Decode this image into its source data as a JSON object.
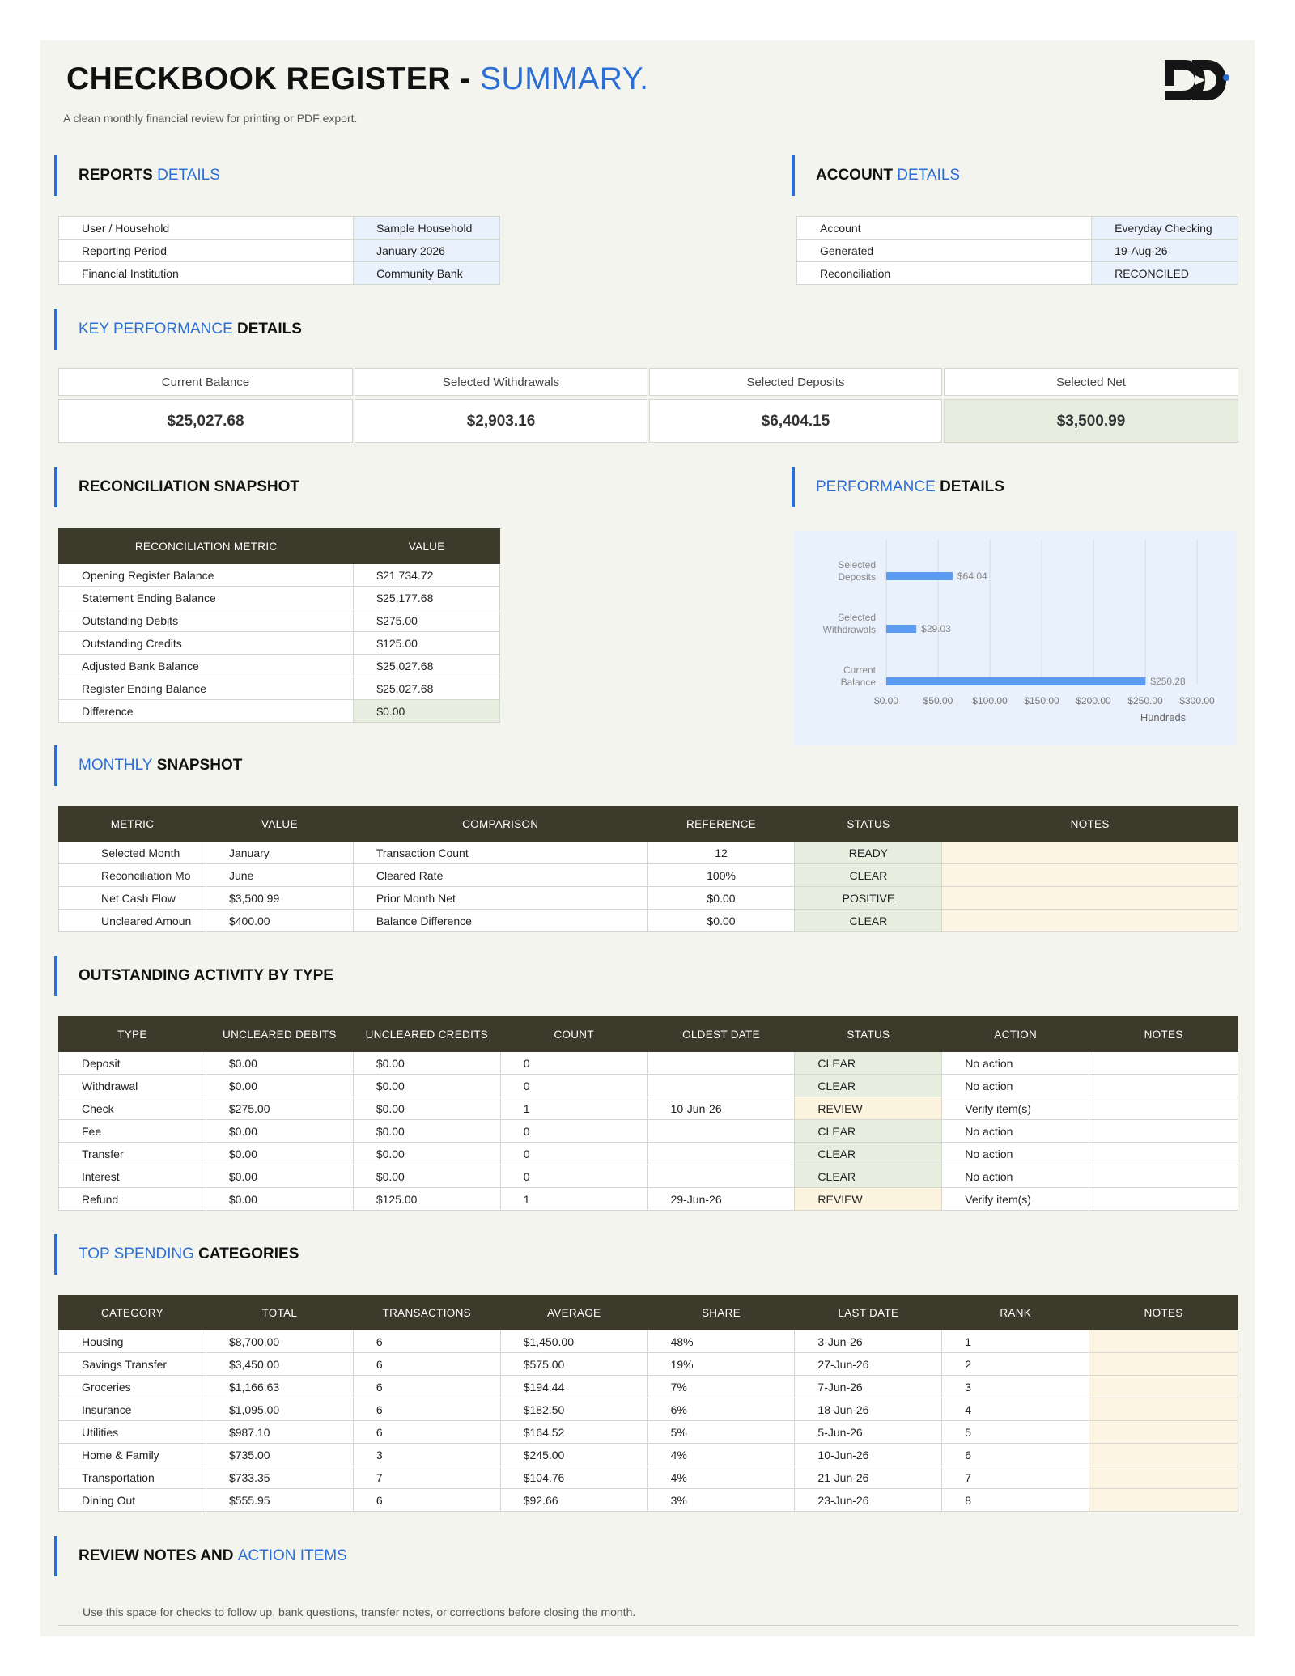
{
  "header": {
    "title_main": "CHECKBOOK REGISTER - ",
    "title_accent": "SUMMARY.",
    "subtitle": "A clean monthly financial review for printing or PDF export."
  },
  "reports": {
    "head_bold": "REPORTS",
    "head_light": "DETAILS",
    "rows": [
      {
        "k": "User / Household",
        "v": "Sample Household"
      },
      {
        "k": "Reporting Period",
        "v": "January 2026"
      },
      {
        "k": "Financial Institution",
        "v": "Community Bank"
      }
    ]
  },
  "account": {
    "head_bold": "ACCOUNT",
    "head_light": "DETAILS",
    "rows": [
      {
        "k": "Account",
        "v": "Everyday Checking"
      },
      {
        "k": "Generated",
        "v": "19-Aug-26"
      },
      {
        "k": "Reconciliation",
        "v": "RECONCILED"
      }
    ]
  },
  "kpi": {
    "head_light": "KEY PERFORMANCE",
    "head_bold": "DETAILS",
    "cards": [
      {
        "label": "Current Balance",
        "value": "$25,027.68"
      },
      {
        "label": "Selected Withdrawals",
        "value": "$2,903.16"
      },
      {
        "label": "Selected Deposits",
        "value": "$6,404.15"
      },
      {
        "label": "Selected Net",
        "value": "$3,500.99"
      }
    ]
  },
  "reconciliation": {
    "head": "RECONCILIATION SNAPSHOT",
    "col_metric": "RECONCILIATION METRIC",
    "col_value": "VALUE",
    "rows": [
      {
        "k": "Opening Register Balance",
        "v": "$21,734.72"
      },
      {
        "k": "Statement Ending Balance",
        "v": "$25,177.68"
      },
      {
        "k": "Outstanding Debits",
        "v": "$275.00"
      },
      {
        "k": "Outstanding Credits",
        "v": "$125.00"
      },
      {
        "k": "Adjusted Bank Balance",
        "v": "$25,027.68"
      },
      {
        "k": "Register Ending Balance",
        "v": "$25,027.68"
      },
      {
        "k": "Difference",
        "v": "$0.00"
      }
    ]
  },
  "performance": {
    "head_light": "PERFORMANCE",
    "head_bold": "DETAILS"
  },
  "chart_data": {
    "type": "bar",
    "orientation": "horizontal",
    "categories": [
      "Selected Deposits",
      "Selected Withdrawals",
      "Current Balance"
    ],
    "category_lines": [
      [
        "Selected",
        "Deposits"
      ],
      [
        "Selected",
        "Withdrawals"
      ],
      [
        "Current",
        "Balance"
      ]
    ],
    "values": [
      64.04,
      29.03,
      250.28
    ],
    "data_labels": [
      "$64.04",
      "$29.03",
      "$250.28"
    ],
    "xlim": [
      0,
      300
    ],
    "xticks": [
      0,
      50,
      100,
      150,
      200,
      250,
      300
    ],
    "xtick_labels": [
      "$0.00",
      "$50.00",
      "$100.00",
      "$150.00",
      "$200.00",
      "$250.00",
      "$300.00"
    ],
    "xunit": "Hundreds",
    "grid": true,
    "bar_color": "#5b9cf2",
    "background": "#e9f1fc"
  },
  "monthly": {
    "head_light": "MONTHLY",
    "head_bold": "SNAPSHOT",
    "columns": [
      "METRIC",
      "VALUE",
      "COMPARISON",
      "REFERENCE",
      "STATUS",
      "NOTES"
    ],
    "rows": [
      {
        "metric": "Selected Month",
        "value": "January",
        "comparison": "Transaction Count",
        "reference": "12",
        "status": "READY",
        "notes": ""
      },
      {
        "metric": "Reconciliation Mo",
        "value": "June",
        "comparison": "Cleared Rate",
        "reference": "100%",
        "status": "CLEAR",
        "notes": ""
      },
      {
        "metric": "Net Cash Flow",
        "value": "$3,500.99",
        "comparison": "Prior Month Net",
        "reference": "$0.00",
        "status": "POSITIVE",
        "notes": ""
      },
      {
        "metric": "Uncleared Amoun",
        "value": "$400.00",
        "comparison": "Balance Difference",
        "reference": "$0.00",
        "status": "CLEAR",
        "notes": ""
      }
    ]
  },
  "outstanding": {
    "head": "OUTSTANDING ACTIVITY BY TYPE",
    "columns": [
      "TYPE",
      "UNCLEARED DEBITS",
      "UNCLEARED CREDITS",
      "COUNT",
      "OLDEST DATE",
      "STATUS",
      "ACTION",
      "NOTES"
    ],
    "rows": [
      {
        "type": "Deposit",
        "debits": "$0.00",
        "credits": "$0.00",
        "count": "0",
        "oldest": "",
        "status": "CLEAR",
        "action": "No action",
        "notes": ""
      },
      {
        "type": "Withdrawal",
        "debits": "$0.00",
        "credits": "$0.00",
        "count": "0",
        "oldest": "",
        "status": "CLEAR",
        "action": "No action",
        "notes": ""
      },
      {
        "type": "Check",
        "debits": "$275.00",
        "credits": "$0.00",
        "count": "1",
        "oldest": "10-Jun-26",
        "status": "REVIEW",
        "action": "Verify item(s)",
        "notes": ""
      },
      {
        "type": "Fee",
        "debits": "$0.00",
        "credits": "$0.00",
        "count": "0",
        "oldest": "",
        "status": "CLEAR",
        "action": "No action",
        "notes": ""
      },
      {
        "type": "Transfer",
        "debits": "$0.00",
        "credits": "$0.00",
        "count": "0",
        "oldest": "",
        "status": "CLEAR",
        "action": "No action",
        "notes": ""
      },
      {
        "type": "Interest",
        "debits": "$0.00",
        "credits": "$0.00",
        "count": "0",
        "oldest": "",
        "status": "CLEAR",
        "action": "No action",
        "notes": ""
      },
      {
        "type": "Refund",
        "debits": "$0.00",
        "credits": "$125.00",
        "count": "1",
        "oldest": "29-Jun-26",
        "status": "REVIEW",
        "action": "Verify item(s)",
        "notes": ""
      }
    ]
  },
  "spending": {
    "head_light": "TOP SPENDING",
    "head_bold": "CATEGORIES",
    "columns": [
      "CATEGORY",
      "TOTAL",
      "TRANSACTIONS",
      "AVERAGE",
      "SHARE",
      "LAST DATE",
      "RANK",
      "NOTES"
    ],
    "rows": [
      {
        "category": "Housing",
        "total": "$8,700.00",
        "tx": "6",
        "avg": "$1,450.00",
        "share": "48%",
        "last": "3-Jun-26",
        "rank": "1",
        "notes": ""
      },
      {
        "category": "Savings Transfer",
        "total": "$3,450.00",
        "tx": "6",
        "avg": "$575.00",
        "share": "19%",
        "last": "27-Jun-26",
        "rank": "2",
        "notes": ""
      },
      {
        "category": "Groceries",
        "total": "$1,166.63",
        "tx": "6",
        "avg": "$194.44",
        "share": "7%",
        "last": "7-Jun-26",
        "rank": "3",
        "notes": ""
      },
      {
        "category": "Insurance",
        "total": "$1,095.00",
        "tx": "6",
        "avg": "$182.50",
        "share": "6%",
        "last": "18-Jun-26",
        "rank": "4",
        "notes": ""
      },
      {
        "category": "Utilities",
        "total": "$987.10",
        "tx": "6",
        "avg": "$164.52",
        "share": "5%",
        "last": "5-Jun-26",
        "rank": "5",
        "notes": ""
      },
      {
        "category": "Home & Family",
        "total": "$735.00",
        "tx": "3",
        "avg": "$245.00",
        "share": "4%",
        "last": "10-Jun-26",
        "rank": "6",
        "notes": ""
      },
      {
        "category": "Transportation",
        "total": "$733.35",
        "tx": "7",
        "avg": "$104.76",
        "share": "4%",
        "last": "21-Jun-26",
        "rank": "7",
        "notes": ""
      },
      {
        "category": "Dining Out",
        "total": "$555.95",
        "tx": "6",
        "avg": "$92.66",
        "share": "3%",
        "last": "23-Jun-26",
        "rank": "8",
        "notes": ""
      }
    ]
  },
  "review": {
    "head_bold": "REVIEW NOTES AND",
    "head_light": "ACTION ITEMS",
    "text": "Use this space for checks to follow up, bank questions, transfer notes, or corrections before closing the month."
  },
  "colors": {
    "accent": "#2b6fd6",
    "header_dark": "#3b3a2b",
    "clear_green": "#e7eedf",
    "review_amber": "#fdf4e0",
    "detail_blue": "#e9f1fc"
  }
}
